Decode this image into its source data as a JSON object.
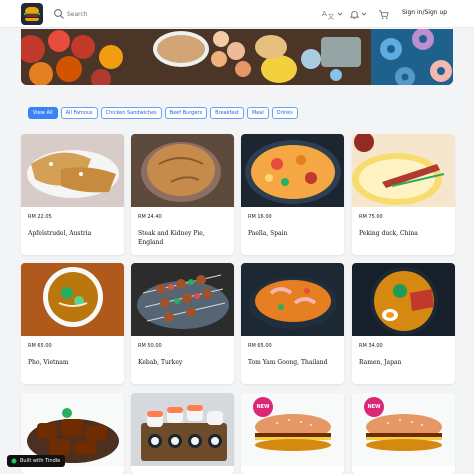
{
  "header": {
    "logo_icon": "burger-logo-icon",
    "search_placeholder": "Search",
    "language_icon": "translate-icon",
    "notifications_icon": "bell-icon",
    "cart_icon": "cart-icon",
    "signin_label": "Sign in/Sign up"
  },
  "categories": [
    {
      "label": "View All",
      "active": true
    },
    {
      "label": "All Famous",
      "active": false
    },
    {
      "label": "Chicken Sandwiches",
      "active": false
    },
    {
      "label": "Beef Burgers",
      "active": false
    },
    {
      "label": "Breakfast",
      "active": false
    },
    {
      "label": "Meal",
      "active": false
    },
    {
      "label": "Drinks",
      "active": false
    }
  ],
  "products": [
    {
      "price": "RM 22.05",
      "name": "Apfelstrudel, Austria"
    },
    {
      "price": "RM 24.40",
      "name": "Steak and Kidney Pie, England"
    },
    {
      "price": "RM 16.00",
      "name": "Paella, Spain"
    },
    {
      "price": "RM 75.00",
      "name": "Peking duck, China"
    },
    {
      "price": "RM 65.00",
      "name": "Pho, Vietnam"
    },
    {
      "price": "RM 50.00",
      "name": "Kebab, Turkey"
    },
    {
      "price": "RM 65.00",
      "name": "Tom Yam Goong, Thailand"
    },
    {
      "price": "RM 34.00",
      "name": "Ramen, Japan"
    },
    {
      "price": "",
      "name": ""
    },
    {
      "price": "",
      "name": ""
    },
    {
      "price": "",
      "name": "",
      "tag": "NEW"
    },
    {
      "price": "",
      "name": "",
      "tag": "NEW"
    }
  ],
  "footer_badge": {
    "label": "Built with Tindle"
  },
  "colors": {
    "accent": "#3b82f6",
    "new_badge": "#db2777"
  }
}
